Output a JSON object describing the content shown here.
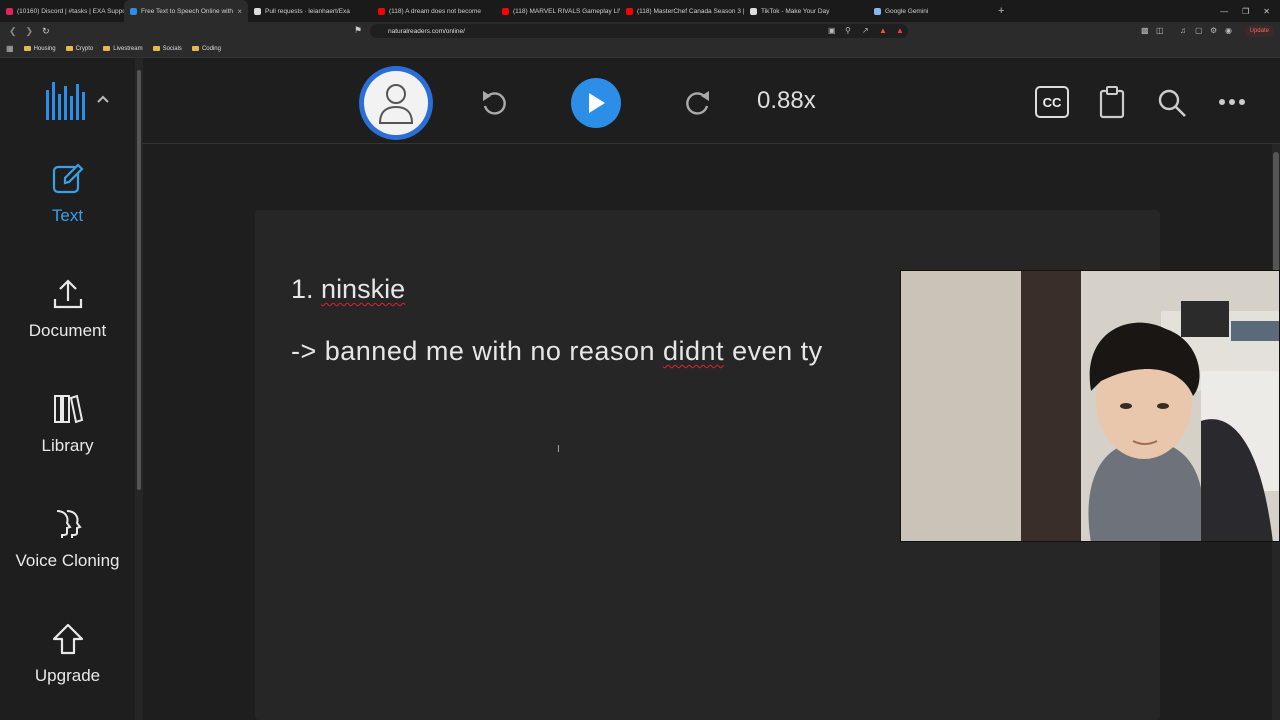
{
  "browser": {
    "tabs": [
      {
        "title": "(10160) Discord | #tasks | EXA Suppo",
        "color": "#e0245e",
        "active": false
      },
      {
        "title": "Free Text to Speech Online with",
        "color": "#2c8ee6",
        "active": true
      },
      {
        "title": "Pull requests · leianhaert/Exa",
        "color": "#dddddd",
        "active": false
      },
      {
        "title": "(118) A dream does not become",
        "color": "#ff0000",
        "active": false
      },
      {
        "title": "(118) MARVEL RIVALS Gameplay LIVI",
        "color": "#ff0000",
        "active": false
      },
      {
        "title": "(118) MasterChef Canada Season 3 |",
        "color": "#ff0000",
        "active": false
      },
      {
        "title": "TikTok - Make Your Day",
        "color": "#dddddd",
        "active": false
      },
      {
        "title": "Google Gemini",
        "color": "#8ab4f8",
        "active": false
      }
    ],
    "new_tab": "+",
    "url": "naturalreaders.com/online/",
    "update_label": "Update",
    "bookmarks": [
      "Housing",
      "Crypto",
      "Livestream",
      "Socials",
      "Coding"
    ]
  },
  "sidebar": {
    "items": [
      {
        "label": "Text",
        "icon": "edit-icon",
        "active": true
      },
      {
        "label": "Document",
        "icon": "upload-icon",
        "active": false
      },
      {
        "label": "Library",
        "icon": "library-icon",
        "active": false
      },
      {
        "label": "Voice Cloning",
        "icon": "voice-cloning-icon",
        "active": false
      },
      {
        "label": "Upgrade",
        "icon": "upgrade-icon",
        "active": false
      }
    ]
  },
  "player": {
    "speed": "0.88x",
    "cc_label": "CC"
  },
  "document": {
    "line1_prefix": "1.",
    "line1_word": "ninskie",
    "line2_prefix": "-> banned me with no reason",
    "line2_spell": "didnt",
    "line2_suffix": "even ty"
  },
  "colors": {
    "accent": "#2c8ee6",
    "active_nav": "#3ba0e6",
    "background": "#1e1e1e",
    "card": "#262626"
  }
}
